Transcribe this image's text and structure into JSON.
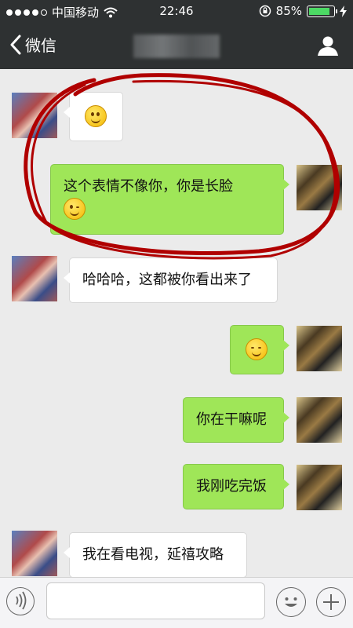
{
  "status_bar": {
    "carrier": "中国移动",
    "time": "22:46",
    "battery_percent": "85%",
    "battery_level": 0.85,
    "signal_icon": "signal-dots-icon",
    "wifi_icon": "wifi-icon",
    "lock_icon": "rotation-lock-icon",
    "charging_icon": "charging-bolt-icon"
  },
  "nav": {
    "back_label": "微信",
    "back_icon": "chevron-left-icon",
    "profile_icon": "person-icon"
  },
  "messages": [
    {
      "side": "friend",
      "type": "emoji",
      "emoji": "smile-emoji"
    },
    {
      "side": "me",
      "text": "这个表情不像你，你是长脸",
      "emoji": "tongue-wink-emoji"
    },
    {
      "side": "friend",
      "text": "哈哈哈，这都被你看出来了"
    },
    {
      "side": "me",
      "type": "emoji",
      "emoji": "squint-grin-emoji"
    },
    {
      "side": "me",
      "text": "你在干嘛呢"
    },
    {
      "side": "me",
      "text": "我刚吃完饭"
    },
    {
      "side": "friend",
      "text": "我在看电视，延禧攻略"
    }
  ],
  "input_bar": {
    "voice_icon": "voice-icon",
    "emoji_icon": "emoji-face-icon",
    "plus_icon": "plus-icon",
    "text_value": ""
  },
  "colors": {
    "header_bg": "#2e3132",
    "chat_bg": "#ebebeb",
    "my_bubble": "#9fe658",
    "friend_bubble": "#ffffff",
    "annotation_red": "#b00000"
  }
}
